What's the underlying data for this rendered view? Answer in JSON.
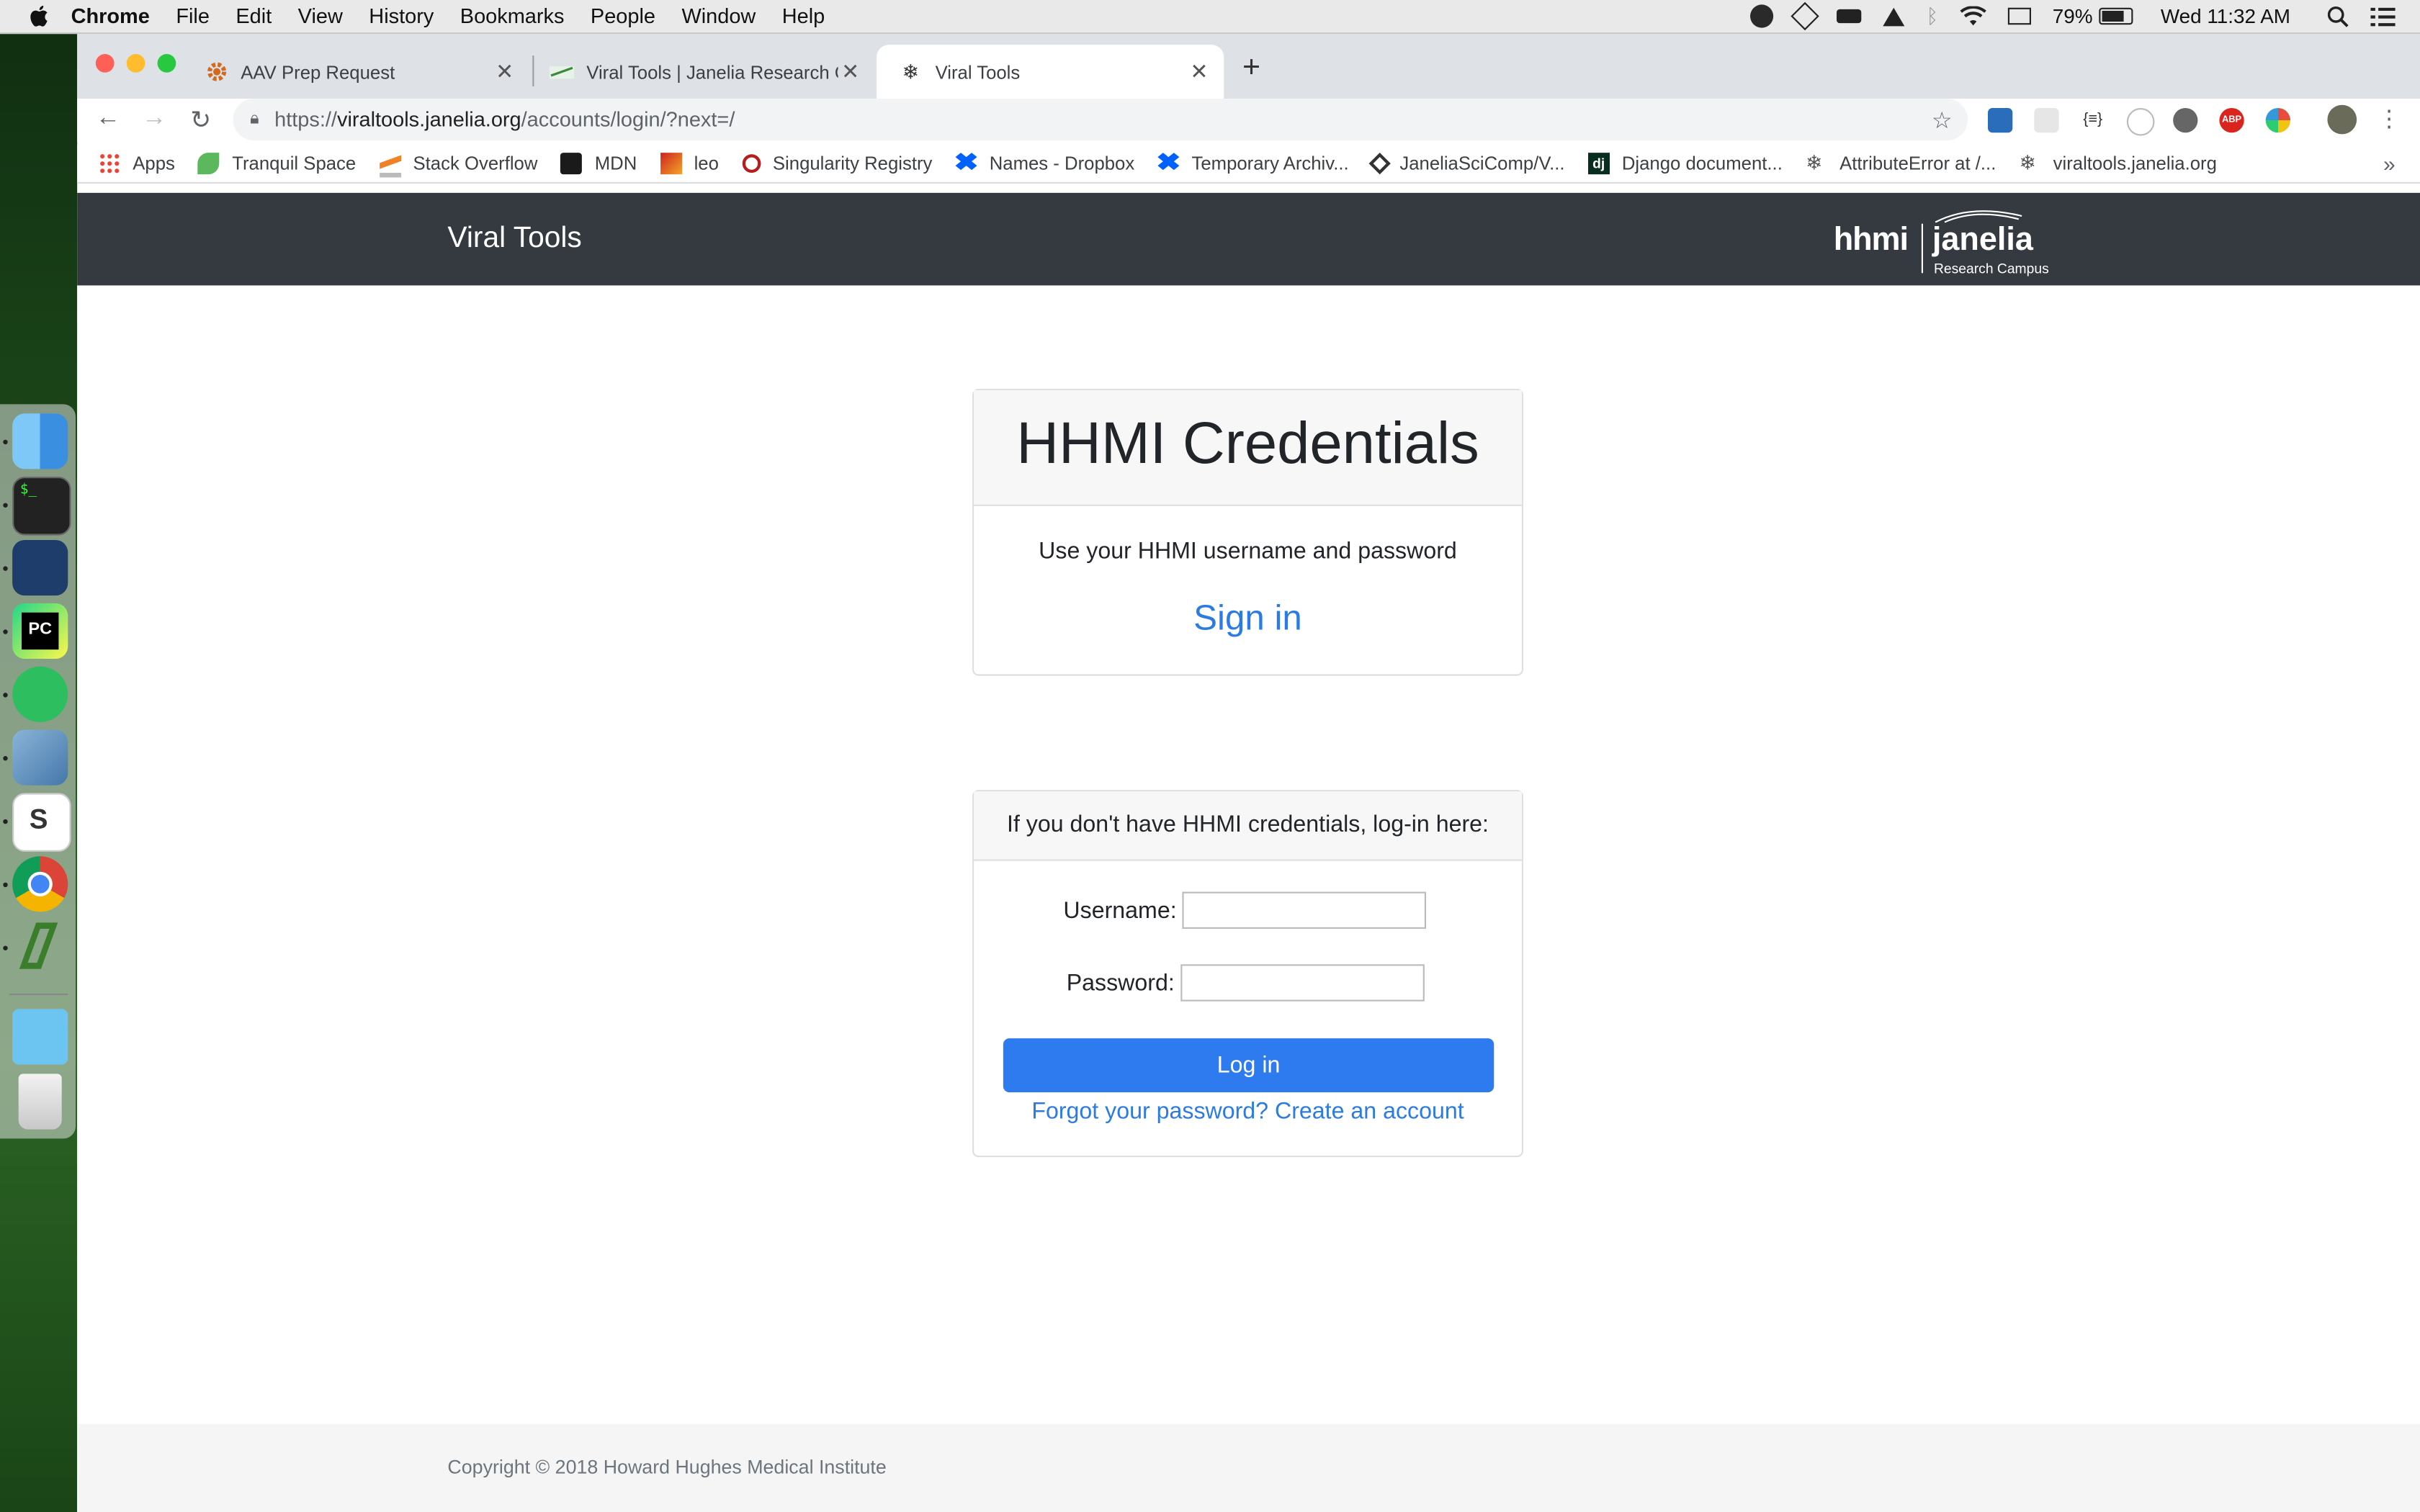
{
  "menubar": {
    "app": "Chrome",
    "items": [
      "File",
      "Edit",
      "View",
      "History",
      "Bookmarks",
      "People",
      "Window",
      "Help"
    ],
    "battery": "79%",
    "clock": "Wed 11:32 AM"
  },
  "tabs": [
    {
      "title": "AAV Prep Request",
      "icon": "gear-icon"
    },
    {
      "title": "Viral Tools | Janelia Research C",
      "icon": "janelia-icon"
    },
    {
      "title": "Viral Tools",
      "icon": "snowflake-icon"
    }
  ],
  "omnibox": {
    "scheme": "https://",
    "host": "viraltools.janelia.org",
    "path": "/accounts/login/?next=/"
  },
  "bookmarks": [
    {
      "label": "Apps",
      "color": "#e94335"
    },
    {
      "label": "Tranquil Space",
      "color": "#5cb85c"
    },
    {
      "label": "Stack Overflow",
      "color": "#f48024"
    },
    {
      "label": "MDN",
      "color": "#1a1a1a"
    },
    {
      "label": "leo",
      "color": "#cc2222"
    },
    {
      "label": "Singularity Registry",
      "color": "#b71c1c"
    },
    {
      "label": "Names - Dropbox",
      "color": "#0061ff"
    },
    {
      "label": "Temporary Archiv...",
      "color": "#0061ff"
    },
    {
      "label": "JaneliaSciComp/V...",
      "color": "#333333"
    },
    {
      "label": "Django document...",
      "color": "#092e20"
    },
    {
      "label": "AttributeError at /...",
      "color": "#555555"
    },
    {
      "label": "viraltools.janelia.org",
      "color": "#555555"
    }
  ],
  "navbar": {
    "brand": "Viral Tools",
    "logo_left": "hhmi",
    "logo_right": "janelia",
    "logo_sub": "Research Campus"
  },
  "credentials_card": {
    "title": "HHMI Credentials",
    "description": "Use your HHMI username and password",
    "signin_link": "Sign in"
  },
  "login_card": {
    "header": "If you don't have HHMI credentials, log-in here:",
    "username_label": "Username:",
    "username_value": "",
    "password_label": "Password:",
    "password_value": "",
    "login_button": "Log in",
    "forgot_link": "Forgot your password?",
    "create_link": "Create an account"
  },
  "footer": {
    "copyright": "Copyright © 2018 Howard Hughes Medical Institute"
  },
  "colors": {
    "navbar_bg": "#343a40",
    "primary": "#2e7bf0",
    "link": "#2c7be5"
  }
}
